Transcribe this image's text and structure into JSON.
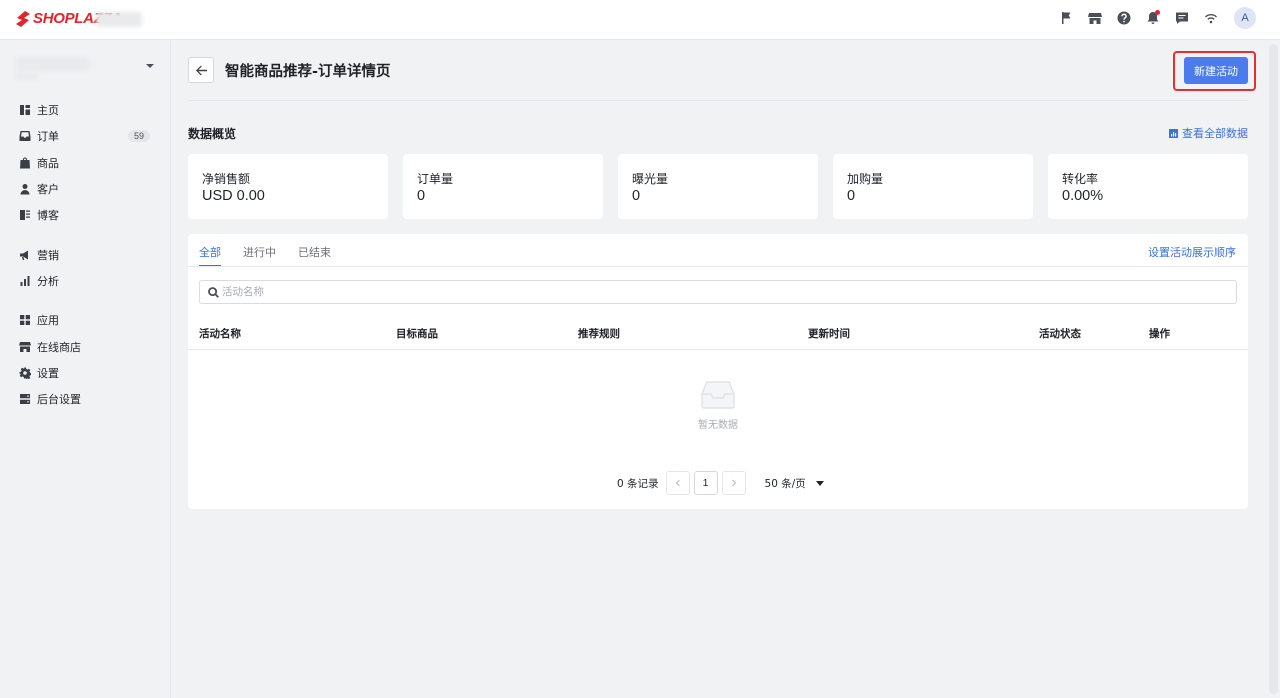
{
  "app": {
    "brand": "SHOPLAZZA"
  },
  "topbar": {
    "icons": [
      "flag-icon",
      "store-icon",
      "help-icon",
      "bell-icon",
      "message-icon",
      "wifi-icon"
    ],
    "avatar_initial": "A"
  },
  "sidebar": {
    "items": [
      {
        "label": "主页",
        "icon": "dashboard-icon"
      },
      {
        "label": "订单",
        "icon": "inbox-icon",
        "badge": "59"
      },
      {
        "label": "商品",
        "icon": "bag-icon"
      },
      {
        "label": "客户",
        "icon": "user-icon"
      },
      {
        "label": "博客",
        "icon": "blog-icon"
      },
      {
        "label": "营销",
        "icon": "megaphone-icon"
      },
      {
        "label": "分析",
        "icon": "bar-chart-icon"
      },
      {
        "label": "应用",
        "icon": "apps-icon"
      },
      {
        "label": "在线商店",
        "icon": "store-icon"
      },
      {
        "label": "设置",
        "icon": "gear-icon"
      },
      {
        "label": "后台设置",
        "icon": "server-icon"
      }
    ]
  },
  "header": {
    "title": "智能商品推荐-订单详情页",
    "new_button": "新建活动"
  },
  "overview": {
    "title": "数据概览",
    "view_all": "查看全部数据",
    "cards": [
      {
        "label": "净销售额",
        "value": "USD 0.00"
      },
      {
        "label": "订单量",
        "value": "0"
      },
      {
        "label": "曝光量",
        "value": "0"
      },
      {
        "label": "加购量",
        "value": "0"
      },
      {
        "label": "转化率",
        "value": "0.00%"
      }
    ]
  },
  "table": {
    "tabs": [
      "全部",
      "进行中",
      "已结束"
    ],
    "sort_link": "设置活动展示顺序",
    "search_placeholder": "活动名称",
    "columns": [
      "活动名称",
      "目标商品",
      "推荐规则",
      "更新时间",
      "活动状态",
      "操作"
    ],
    "empty_text": "暂无数据",
    "pagination": {
      "total": "0 条记录",
      "current_page": "1",
      "page_size": "50 条/页"
    }
  }
}
